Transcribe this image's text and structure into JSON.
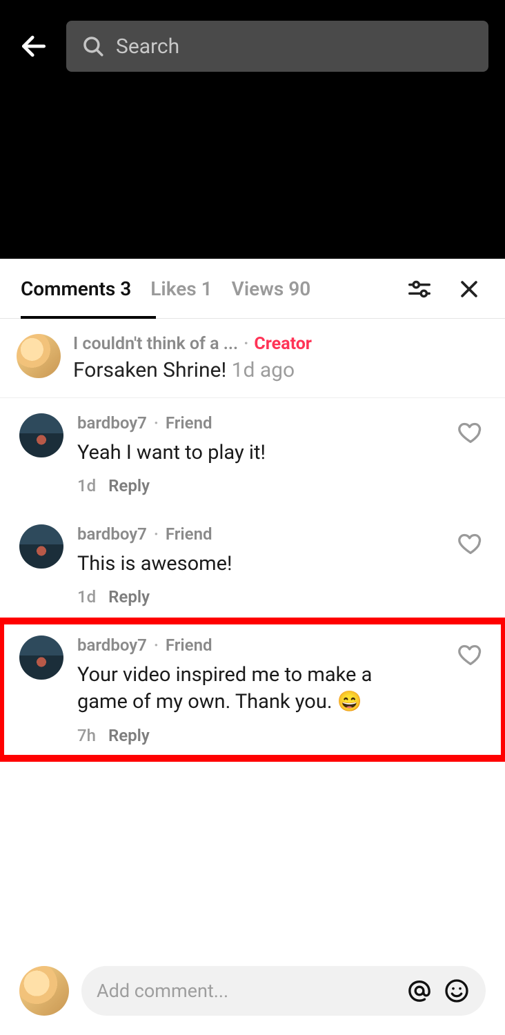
{
  "search": {
    "placeholder": "Search"
  },
  "tabs": {
    "comments": {
      "label": "Comments",
      "count": 3
    },
    "likes": {
      "label": "Likes",
      "count": 1
    },
    "views": {
      "label": "Views",
      "count": 90
    }
  },
  "pinned": {
    "username": "I couldn't think of a ...",
    "badge": "Creator",
    "title": "Forsaken Shrine!",
    "ago": "1d ago"
  },
  "comments": [
    {
      "username": "bardboy7",
      "relation": "Friend",
      "text": "Yeah I want to play it!",
      "ago": "1d",
      "reply_label": "Reply",
      "highlighted": false
    },
    {
      "username": "bardboy7",
      "relation": "Friend",
      "text": "This is awesome!",
      "ago": "1d",
      "reply_label": "Reply",
      "highlighted": false
    },
    {
      "username": "bardboy7",
      "relation": "Friend",
      "text": "Your video inspired me to make a game of my own. Thank you. 😄",
      "ago": "7h",
      "reply_label": "Reply",
      "highlighted": true
    }
  ],
  "composer": {
    "placeholder": "Add comment..."
  }
}
